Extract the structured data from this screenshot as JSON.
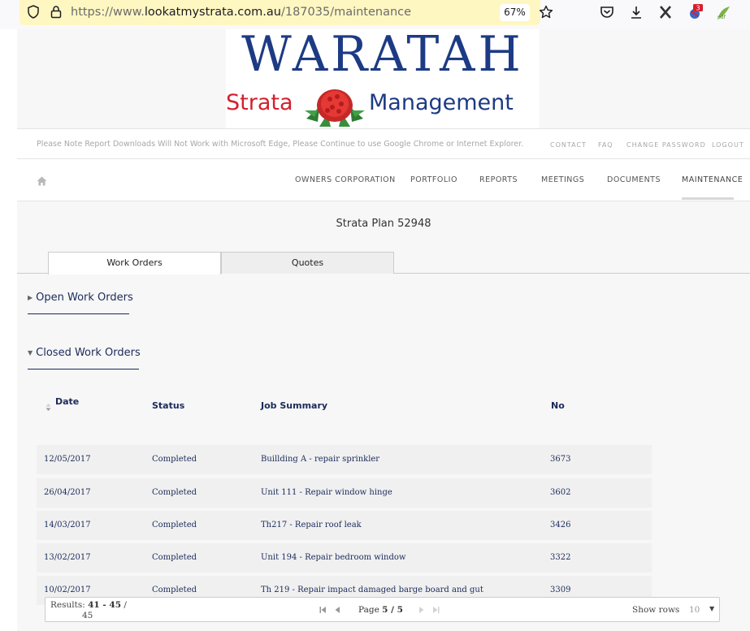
{
  "browser": {
    "url_prefix": "https://www.",
    "url_domain": "lookatmystrata.com.au",
    "url_path": "/187035/maintenance",
    "zoom": "67%",
    "badge_count": "3"
  },
  "logo": {
    "line1": "WARATAH",
    "line2_left": "Strata",
    "line2_right": "Management"
  },
  "notice": "Please Note Report Downloads Will Not Work with Microsoft Edge, Please Continue to use Google Chrome or Internet Explorer.",
  "top_links": [
    "CONTACT",
    "FAQ",
    "CHANGE PASSWORD",
    "LOGOUT"
  ],
  "nav": [
    "OWNERS CORPORATION",
    "PORTFOLIO",
    "REPORTS",
    "MEETINGS",
    "DOCUMENTS",
    "MAINTENANCE"
  ],
  "plan_title": "Strata Plan 52948",
  "tabs": [
    "Work Orders",
    "Quotes"
  ],
  "sections": {
    "open": "Open Work Orders",
    "closed": "Closed Work Orders"
  },
  "table": {
    "headers": [
      "Date",
      "Status",
      "Job Summary",
      "No"
    ],
    "rows": [
      [
        "12/05/2017",
        "Completed",
        "Buillding A - repair sprinkler",
        "3673"
      ],
      [
        "26/04/2017",
        "Completed",
        "Unit 111 - Repair window hinge",
        "3602"
      ],
      [
        "14/03/2017",
        "Completed",
        "Th217 - Repair roof leak",
        "3426"
      ],
      [
        "13/02/2017",
        "Completed",
        "Unit 194 - Repair bedroom window",
        "3322"
      ],
      [
        "10/02/2017",
        "Completed",
        "Th 219 - Repair impact damaged barge board and gut",
        "3309"
      ]
    ]
  },
  "pager": {
    "results_label": "Results:",
    "range": "41 - 45",
    "slash": "/",
    "total": "45",
    "page_label": "Page",
    "page_value": "5 / 5",
    "show_rows_label": "Show rows",
    "rows_value": "10"
  },
  "colors": {
    "navy": "#1b2a5a",
    "brand_blue": "#1d3a84",
    "brand_red": "#d4202e",
    "urlbar": "#fff7c2"
  }
}
